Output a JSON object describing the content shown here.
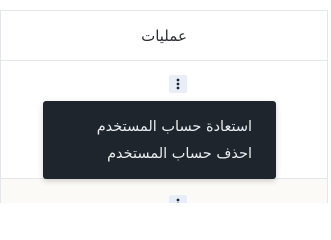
{
  "table": {
    "header": "عمليات"
  },
  "actions_menu": {
    "items": [
      {
        "label": "استعادة حساب المستخدم"
      },
      {
        "label": "احذف حساب المستخدم"
      }
    ]
  },
  "icons": {
    "row_actions": "vertical-ellipsis-icon"
  },
  "colors": {
    "menu_background": "#1f252d",
    "menu_text": "#e9ecef",
    "kebab_background": "#e7eef7",
    "border": "#e3e6ea",
    "alt_row": "#fbfaf6"
  }
}
